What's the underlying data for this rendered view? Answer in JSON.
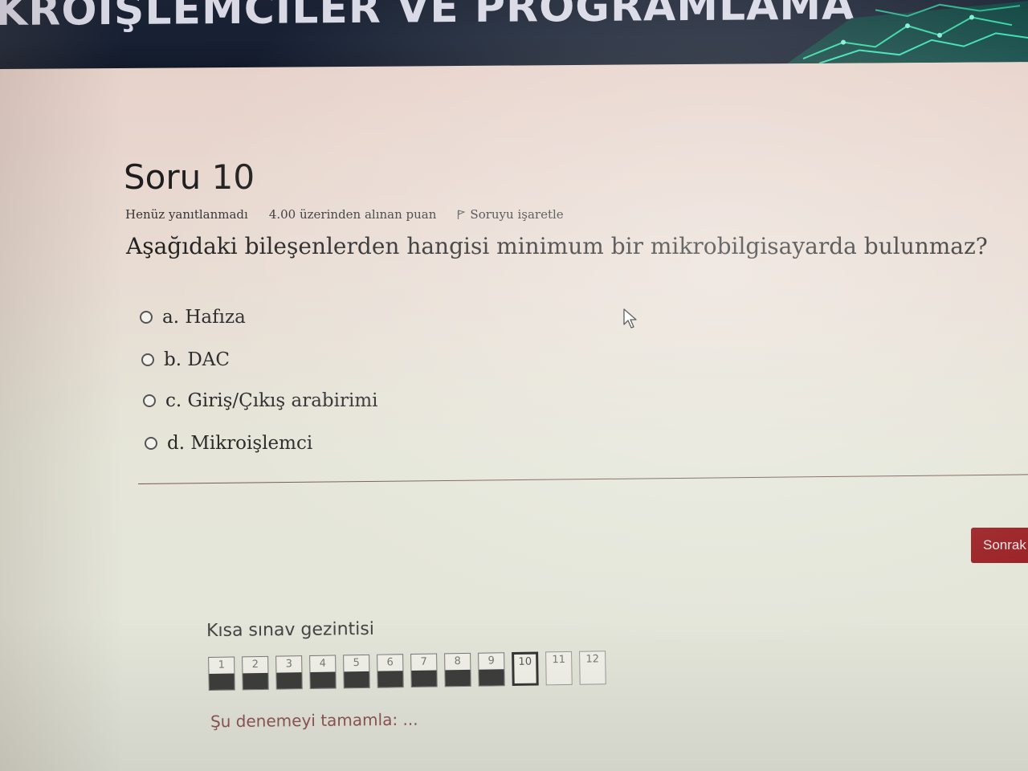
{
  "header": {
    "title": "KROİŞLEMCİLER VE PROGRAMLAMA"
  },
  "question": {
    "title": "Soru 10",
    "status": "Henüz yanıtlanmadı",
    "grade": "4.00 üzerinden alınan puan",
    "flag_label": "Soruyu işaretle",
    "text": "Aşağıdaki bileşenlerden hangisi minimum bir mikrobilgisayarda bulunmaz?",
    "answers": [
      {
        "label": "a. Hafıza",
        "selected": false
      },
      {
        "label": "b. DAC",
        "selected": false
      },
      {
        "label": "c. Giriş/Çıkış arabirimi",
        "selected": false
      },
      {
        "label": "d. Mikroişlemci",
        "selected": false
      }
    ]
  },
  "actions": {
    "next_label": "Sonrak"
  },
  "navigation": {
    "title": "Kısa sınav gezintisi",
    "buttons": [
      {
        "label": "1",
        "state": "answered"
      },
      {
        "label": "2",
        "state": "answered"
      },
      {
        "label": "3",
        "state": "answered"
      },
      {
        "label": "4",
        "state": "answered"
      },
      {
        "label": "5",
        "state": "answered"
      },
      {
        "label": "6",
        "state": "answered"
      },
      {
        "label": "7",
        "state": "answered"
      },
      {
        "label": "8",
        "state": "answered"
      },
      {
        "label": "9",
        "state": "answered"
      },
      {
        "label": "10",
        "state": "current"
      },
      {
        "label": "11",
        "state": "empty"
      },
      {
        "label": "12",
        "state": "empty"
      }
    ],
    "finish_label": "Şu denemeyi tamamla: ..."
  },
  "colors": {
    "header_bg": "#172133",
    "accent": "#9a1f23",
    "answered_fill": "#3a3a3a"
  }
}
